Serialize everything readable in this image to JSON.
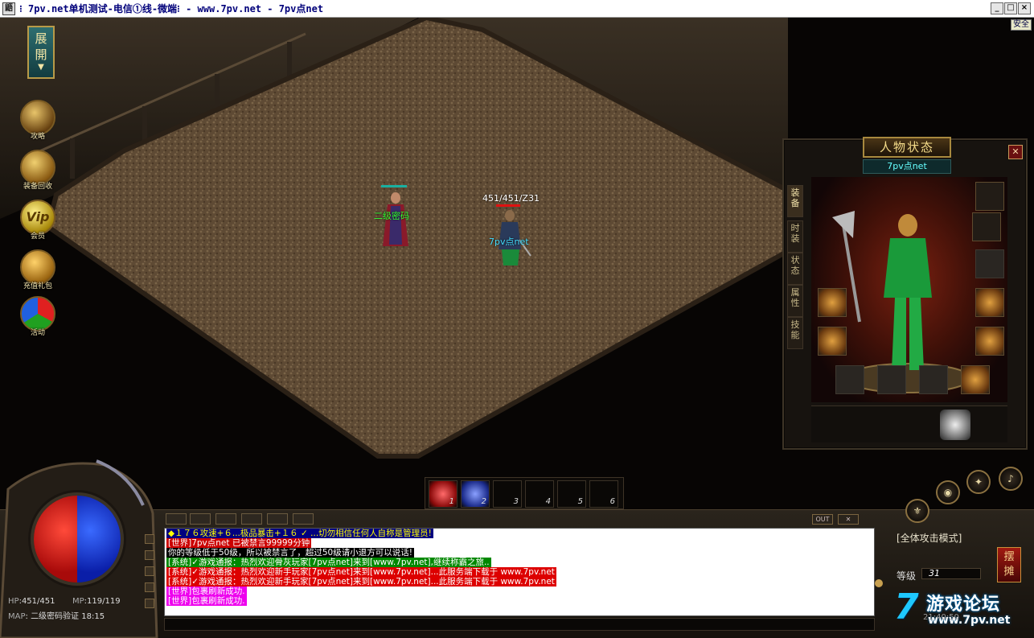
{
  "window": {
    "title": "⁝ 7pv.net单机测试-电信①线-微端⁝ - www.7pv.net - 7pv点net",
    "icon_label": "鼯",
    "minimize_glyph": "_",
    "maximize_glyph": "□",
    "close_glyph": "×",
    "safe_label": "安全"
  },
  "left_menu": {
    "expand_label": "展\n開",
    "items": [
      {
        "label": "攻略",
        "icon": "scroll-icon"
      },
      {
        "label": "装备回收",
        "icon": "recycle-pot-icon"
      },
      {
        "label": "会员",
        "icon": "vip-icon",
        "badge": "Vip"
      },
      {
        "label": "充值礼包",
        "icon": "gift-chest-icon"
      },
      {
        "label": "活动",
        "icon": "balloons-icon"
      }
    ]
  },
  "scene": {
    "npc": {
      "name": "二级密码",
      "name_color": "#33ff33"
    },
    "player": {
      "name": "7pv点net",
      "hp_text": "451/451/Z31",
      "name_color": "#44ddff"
    }
  },
  "char_panel": {
    "title": "人物状态",
    "player_name": "7pv点net",
    "tabs": [
      "装备",
      "时装",
      "状态",
      "属性",
      "技能"
    ],
    "active_tab": "装备",
    "close_glyph": "✕"
  },
  "skillbar": {
    "slots": [
      {
        "key": "1",
        "icon": "fire-skill-icon"
      },
      {
        "key": "2",
        "icon": "ice-skill-icon"
      },
      {
        "key": "3"
      },
      {
        "key": "4"
      },
      {
        "key": "5"
      },
      {
        "key": "6"
      }
    ]
  },
  "stats": {
    "hp_label": "HP",
    "hp": "451/451",
    "mp_label": "MP",
    "mp": "119/119",
    "map_label": "MAP",
    "map": "二级密码验证",
    "time": "18:15",
    "hp_fill": 1.0,
    "mp_fill": 1.0
  },
  "chat": {
    "out_label": "OUT",
    "lines": [
      {
        "text": "◆１７６攻速+６...极品暴击+１６ ✓ ...切勿相信任何人自称是管理员!",
        "fg": "#ffff00",
        "bg": "#000080"
      },
      {
        "text": "[世界]7pv点net 已被禁言99999分钟",
        "fg": "#ffffff",
        "bg": "#cc0000"
      },
      {
        "text": "你的等级低于50级，所以被禁言了，超过50级请小退方可以说话!",
        "fg": "#ffffff",
        "bg": "#000000"
      },
      {
        "text": "[系统]✓游戏通报：热烈欢迎骨灰玩家[7pv点net]来到[www.7pv.net],继续称霸之旅..",
        "fg": "#ffffff",
        "bg": "#008800"
      },
      {
        "text": "[系统]✓游戏通报：热烈欢迎新手玩家[7pv点net]来到[www.7pv.net]...此服务端下载于 www.7pv.net",
        "fg": "#ffffff",
        "bg": "#dd0000"
      },
      {
        "text": "[系统]✓游戏通报：热烈欢迎新手玩家[7pv点net]来到[www.7pv.net]...此服务端下载于 www.7pv.net",
        "fg": "#ffffff",
        "bg": "#dd0000"
      },
      {
        "text": "[世界]包裹刷新成功.",
        "fg": "#ffffff",
        "bg": "#ee00ee"
      },
      {
        "text": "[世界]包裹刷新成功.",
        "fg": "#ffffff",
        "bg": "#ee00ee"
      }
    ]
  },
  "right_panel": {
    "mode": "[全体攻击模式]",
    "level_label": "等级",
    "level": "31",
    "tan_label": "摆\n摊"
  },
  "watermark": {
    "digit": "7",
    "text": "游戏论坛",
    "url": "www.7pv.net",
    "clock": "21:40:50"
  },
  "colors": {
    "panel_gold": "#a8893e",
    "hp_red": "#d01010",
    "mp_blue": "#1030d0"
  }
}
